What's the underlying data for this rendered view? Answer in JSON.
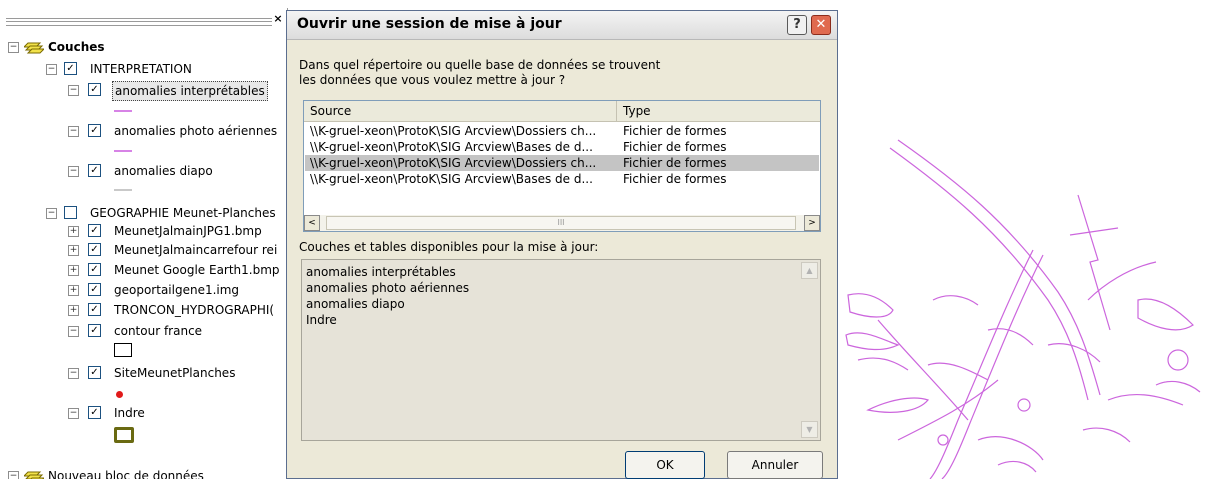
{
  "toc": {
    "close_glyph": "×",
    "root": {
      "label": "Couches",
      "expander": "⊟",
      "icon": "layers-icon"
    },
    "interpretation": {
      "label": "INTERPRETATION",
      "checked": true
    },
    "layers": [
      {
        "label": "anomalies interprétables",
        "checked": true,
        "selected": true,
        "swatch": "line",
        "color": "#d783e6"
      },
      {
        "label": "anomalies photo aériennes",
        "checked": true,
        "swatch": "line",
        "color": "#d783e6"
      },
      {
        "label": "anomalies diapo",
        "checked": true,
        "swatch": "line",
        "color": "#c9c9c9"
      }
    ],
    "geographie": {
      "label": "GEOGRAPHIE Meunet-Planches",
      "checked": false
    },
    "geo_layers": [
      {
        "label": "MeunetJalmainJPG1.bmp",
        "checked": true,
        "expander": "+"
      },
      {
        "label": "MeunetJalmaincarrefour rei",
        "checked": true,
        "expander": "+"
      },
      {
        "label": "Meunet Google Earth1.bmp",
        "checked": true,
        "expander": "+"
      },
      {
        "label": "geoportailgene1.img",
        "checked": true,
        "expander": "+"
      },
      {
        "label": "TRONCON_HYDROGRAPHI(",
        "checked": true,
        "expander": "+"
      },
      {
        "label": "contour france",
        "checked": true,
        "expander": "−",
        "swatch": "square"
      },
      {
        "label": "SiteMeunetPlanches",
        "checked": true,
        "expander": "−",
        "swatch": "dot"
      },
      {
        "label": "Indre",
        "checked": true,
        "expander": "−",
        "swatch": "olive-square"
      }
    ],
    "new_frame": {
      "label": "Nouveau bloc de données"
    }
  },
  "dialog": {
    "title": "Ouvrir une session de mise à jour",
    "help_label": "?",
    "close_label": "✕",
    "prompt_line1": "Dans quel répertoire ou quelle base de données se trouvent",
    "prompt_line2": "les données que vous voulez mettre à jour ?",
    "columns": {
      "source": "Source",
      "type": "Type"
    },
    "rows": [
      {
        "source": "\\\\K-gruel-xeon\\ProtoK\\SIG Arcview\\Dossiers ch...",
        "type": "Fichier de formes",
        "selected": false
      },
      {
        "source": "\\\\K-gruel-xeon\\ProtoK\\SIG Arcview\\Bases de d...",
        "type": "Fichier de formes",
        "selected": false
      },
      {
        "source": "\\\\K-gruel-xeon\\ProtoK\\SIG Arcview\\Dossiers ch...",
        "type": "Fichier de formes",
        "selected": true
      },
      {
        "source": "\\\\K-gruel-xeon\\ProtoK\\SIG Arcview\\Bases de d...",
        "type": "Fichier de formes",
        "selected": false
      }
    ],
    "scroll_left": "<",
    "scroll_right": ">",
    "scroll_thumb": "III",
    "available_label": "Couches et tables disponibles pour la mise à jour:",
    "available_items": [
      "anomalies interprétables",
      "anomalies photo aériennes",
      "anomalies diapo",
      "Indre"
    ],
    "scroll_up": "▲",
    "scroll_down": "▼",
    "ok_label": "OK",
    "cancel_label": "Annuler"
  },
  "map": {
    "stroke_color": "#cc66dd"
  }
}
